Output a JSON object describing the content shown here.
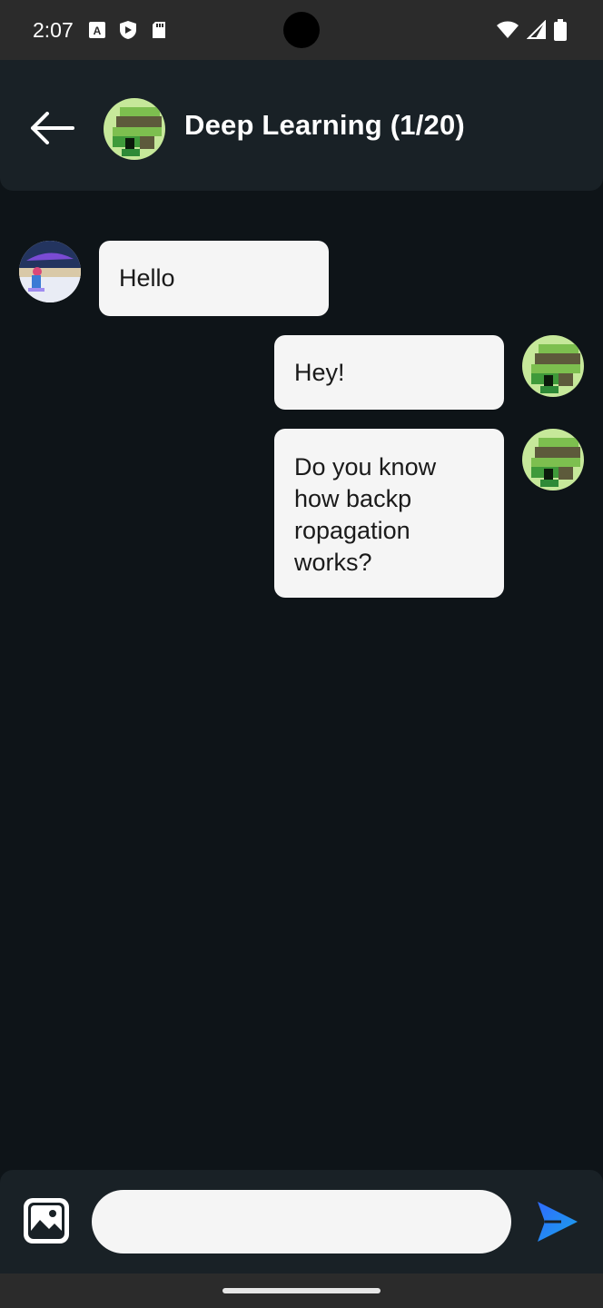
{
  "status_bar": {
    "time": "2:07",
    "icons_left": [
      "text-icon",
      "shield-icon",
      "play-store-icon",
      "sd-card-icon"
    ],
    "icons_right": [
      "wifi-icon",
      "signal-icon",
      "battery-icon"
    ]
  },
  "header": {
    "back_icon": "arrow-left-icon",
    "title": "Deep Learning (1/20)"
  },
  "messages": [
    {
      "sender": "other",
      "text": "Hello"
    },
    {
      "sender": "me",
      "text": "Hey!"
    },
    {
      "sender": "me",
      "text": "Do you know how backpropagation works?",
      "lines": [
        "Do you know",
        "how backp",
        "ropagation",
        "works?"
      ]
    }
  ],
  "composer": {
    "input_value": "",
    "placeholder": "",
    "image_icon": "image-icon",
    "send_icon": "send-icon"
  },
  "colors": {
    "background": "#0e1418",
    "header": "#192126",
    "bubble": "#f5f5f5",
    "send_accent": "#3a6df0"
  }
}
